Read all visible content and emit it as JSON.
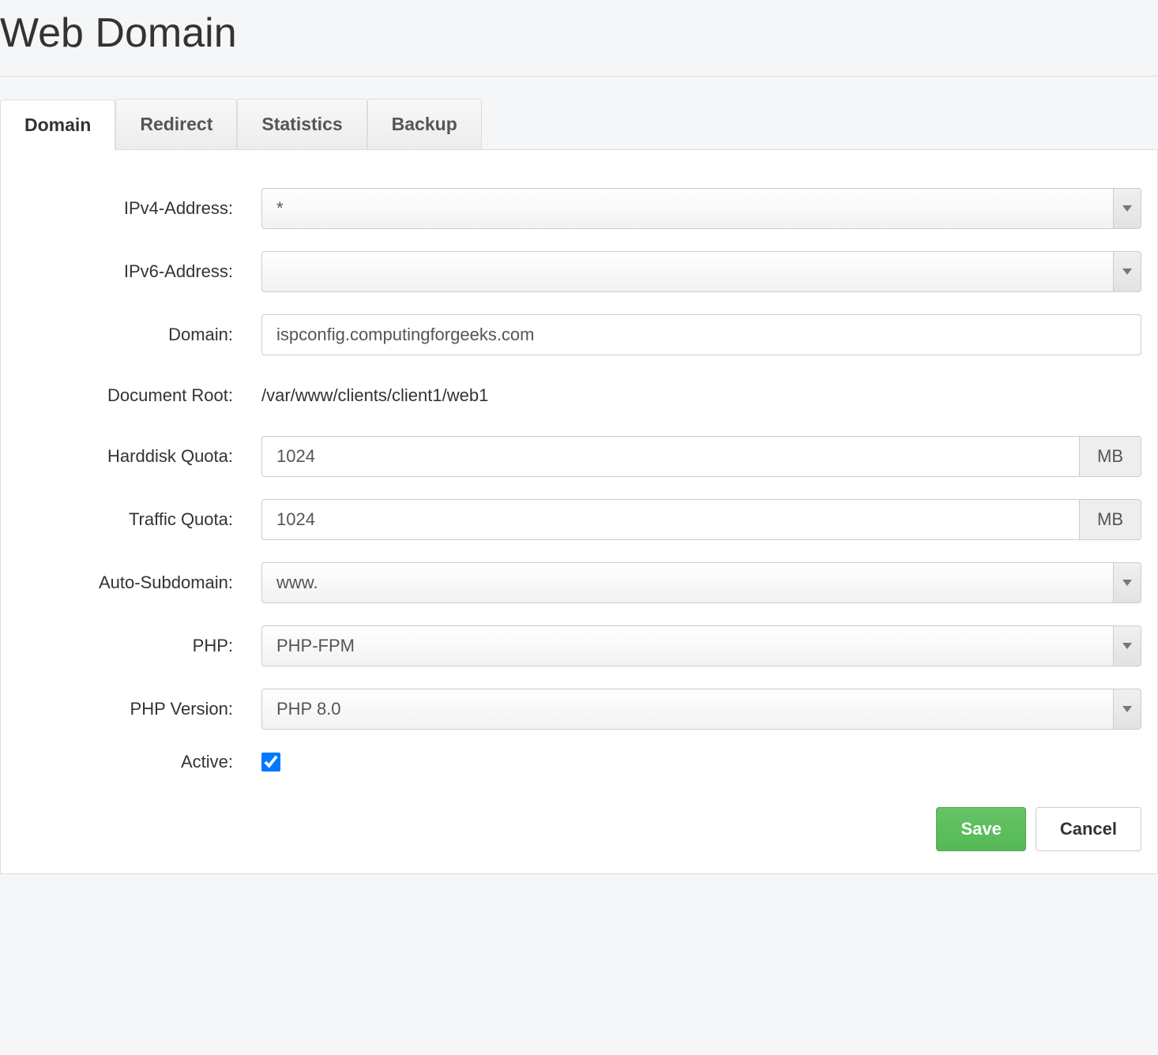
{
  "page_title": "Web Domain",
  "tabs": [
    {
      "label": "Domain",
      "active": true
    },
    {
      "label": "Redirect",
      "active": false
    },
    {
      "label": "Statistics",
      "active": false
    },
    {
      "label": "Backup",
      "active": false
    }
  ],
  "form": {
    "ipv4": {
      "label": "IPv4-Address:",
      "value": "*"
    },
    "ipv6": {
      "label": "IPv6-Address:",
      "value": ""
    },
    "domain": {
      "label": "Domain:",
      "value": "ispconfig.computingforgeeks.com"
    },
    "docroot": {
      "label": "Document Root:",
      "value": "/var/www/clients/client1/web1"
    },
    "hd_quota": {
      "label": "Harddisk Quota:",
      "value": "1024",
      "unit": "MB"
    },
    "traffic_quota": {
      "label": "Traffic Quota:",
      "value": "1024",
      "unit": "MB"
    },
    "auto_subdomain": {
      "label": "Auto-Subdomain:",
      "value": "www."
    },
    "php": {
      "label": "PHP:",
      "value": "PHP-FPM"
    },
    "php_version": {
      "label": "PHP Version:",
      "value": "PHP 8.0"
    },
    "active": {
      "label": "Active:",
      "checked": true
    }
  },
  "buttons": {
    "save": "Save",
    "cancel": "Cancel"
  }
}
